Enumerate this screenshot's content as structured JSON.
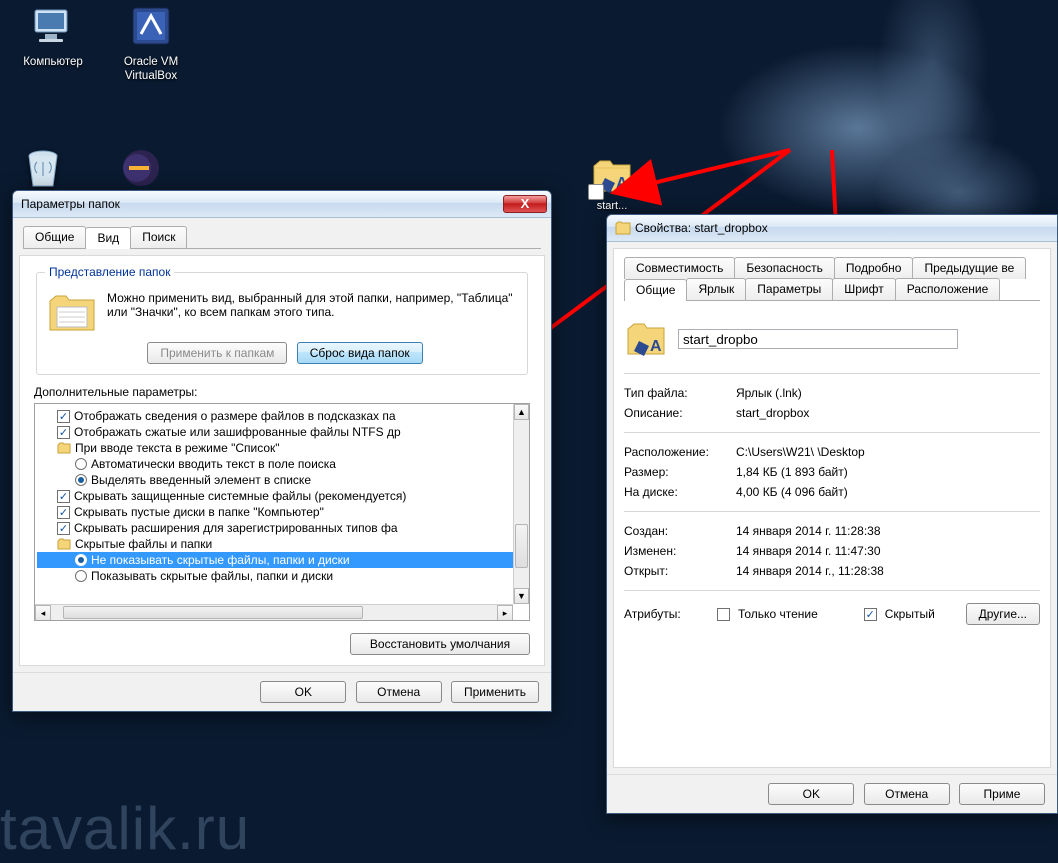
{
  "watermark": "tavalik.ru",
  "desktop": {
    "icons": {
      "computer": "Компьютер",
      "virtualbox": "Oracle VM VirtualBox",
      "shortcut": "start..."
    }
  },
  "folderOptions": {
    "title": "Параметры папок",
    "tabs": {
      "general": "Общие",
      "view": "Вид",
      "search": "Поиск"
    },
    "group_legend": "Представление папок",
    "group_text": "Можно применить вид, выбранный для этой папки, например, \"Таблица\" или \"Значки\", ко всем папкам этого типа.",
    "btn_apply_to_folders": "Применить к папкам",
    "btn_reset_folders": "Сброс вида папок",
    "advanced_label": "Дополнительные параметры:",
    "items": {
      "i1": "Отображать сведения о размере файлов в подсказках па",
      "i2": "Отображать сжатые или зашифрованные файлы NTFS др",
      "i3": "При вводе текста в режиме \"Список\"",
      "i3a": "Автоматически вводить текст в поле поиска",
      "i3b": "Выделять введенный элемент в списке",
      "i4": "Скрывать защищенные системные файлы (рекомендуется)",
      "i5": "Скрывать пустые диски в папке \"Компьютер\"",
      "i6": "Скрывать расширения для зарегистрированных типов фа",
      "i7": "Скрытые файлы и папки",
      "i7a": "Не показывать скрытые файлы, папки и диски",
      "i7b": "Показывать скрытые файлы, папки и диски"
    },
    "btn_restore": "Восстановить умолчания",
    "btn_ok": "OK",
    "btn_cancel": "Отмена",
    "btn_apply": "Применить"
  },
  "props": {
    "title": "Свойства: start_dropbox",
    "tabs": {
      "compat": "Совместимость",
      "security": "Безопасность",
      "details": "Подробно",
      "previous": "Предыдущие ве",
      "general": "Общие",
      "shortcut": "Ярлык",
      "params": "Параметры",
      "font": "Шрифт",
      "layout": "Расположение"
    },
    "name_value": "start_dropbo",
    "fields": {
      "type_k": "Тип файла:",
      "type_v": "Ярлык (.lnk)",
      "desc_k": "Описание:",
      "desc_v": "start_dropbox",
      "loc_k": "Расположение:",
      "loc_v": "C:\\Users\\W21\\ \\Desktop",
      "size_k": "Размер:",
      "size_v": "1,84 КБ (1 893 байт)",
      "ondisk_k": "На диске:",
      "ondisk_v": "4,00 КБ (4 096 байт)",
      "created_k": "Создан:",
      "created_v": "14 января 2014 г. 11:28:38",
      "modified_k": "Изменен:",
      "modified_v": "14 января 2014 г. 11:47:30",
      "accessed_k": "Открыт:",
      "accessed_v": "14 января 2014 г., 11:28:38",
      "attrs_k": "Атрибуты:"
    },
    "readonly": "Только чтение",
    "hidden": "Скрытый",
    "btn_other": "Другие...",
    "btn_ok": "OK",
    "btn_cancel": "Отмена",
    "btn_apply": "Приме"
  }
}
